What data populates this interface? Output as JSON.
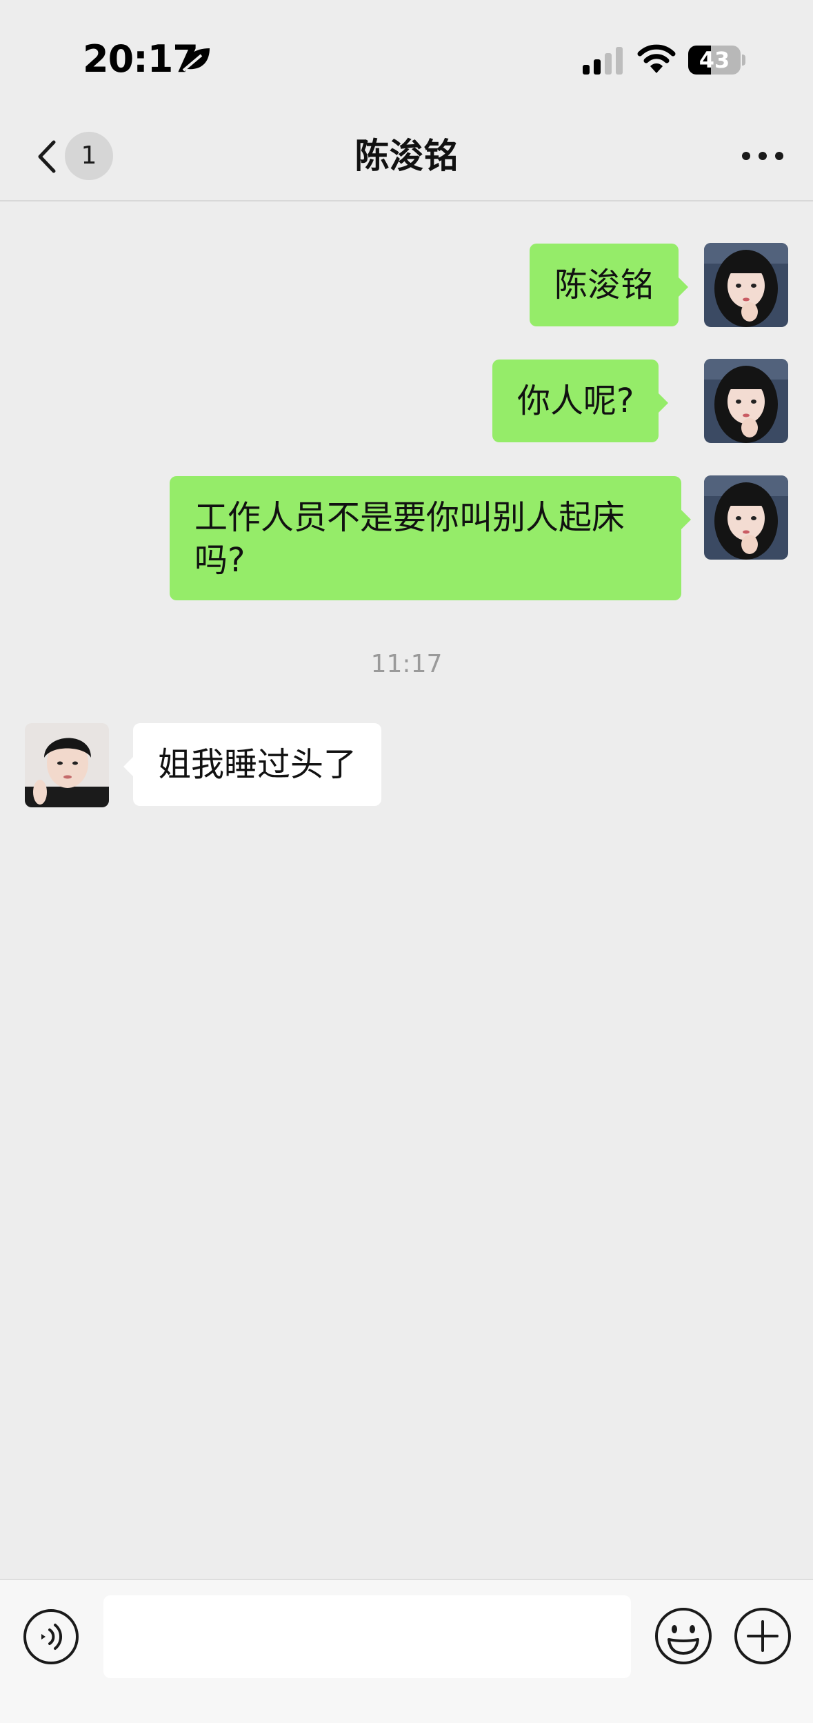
{
  "status_bar": {
    "time": "20:17",
    "battery_level": "43",
    "battery_fraction": 0.43,
    "icons": [
      "leaf-icon",
      "cellular-signal-icon",
      "wifi-icon",
      "battery-icon"
    ]
  },
  "nav": {
    "title": "陈浚铭",
    "unread_count": "1",
    "icons": [
      "chevron-left-icon",
      "more-icon"
    ]
  },
  "messages": [
    {
      "direction": "out",
      "text": "陈浚铭"
    },
    {
      "direction": "out",
      "text": "你人呢?"
    },
    {
      "direction": "out",
      "text": "工作人员不是要你叫别人起床吗?"
    },
    {
      "type": "timestamp",
      "text": "11:17"
    },
    {
      "direction": "in",
      "text": "姐我睡过头了"
    }
  ],
  "input_bar": {
    "placeholder": "",
    "icons": [
      "voice-icon",
      "emoji-icon",
      "plus-icon"
    ]
  },
  "colors": {
    "background": "#ededed",
    "outgoing_bubble": "#95ec69",
    "incoming_bubble": "#ffffff",
    "timestamp_text": "#9a9a9a"
  }
}
